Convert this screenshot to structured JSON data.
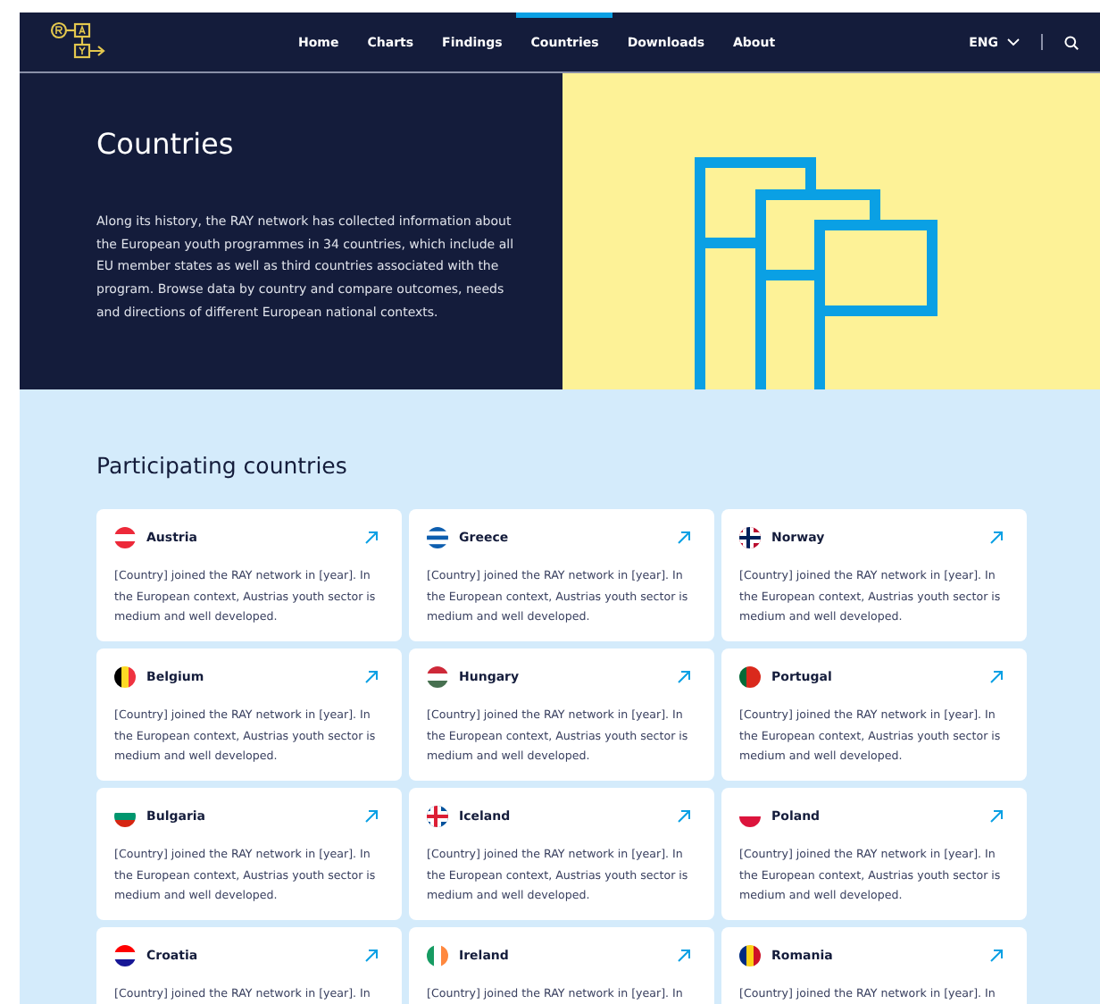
{
  "nav": {
    "links": [
      {
        "label": "Home",
        "selected": false
      },
      {
        "label": "Charts",
        "selected": false
      },
      {
        "label": "Findings",
        "selected": false
      },
      {
        "label": "Countries",
        "selected": true
      },
      {
        "label": "Downloads",
        "selected": false
      },
      {
        "label": "About",
        "selected": false
      }
    ],
    "language": "ENG"
  },
  "hero": {
    "title": "Countries",
    "text": "Along its history, the RAY network has collected information about the European youth programmes in 34 countries, which include all EU member states as well as third countries associated with the program. Browse data by country and compare outcomes, needs and directions of different European national contexts."
  },
  "section": {
    "title": "Participating countries",
    "countries": [
      {
        "name": "Austria",
        "flag": {
          "kind": "horizontal",
          "stripes": [
            {
              "color": "#ed2939"
            },
            {
              "color": "#ffffff"
            },
            {
              "color": "#ed2939"
            }
          ]
        },
        "text": "[Country] joined the RAY network in [year]. In the European context, Austrias youth sector is medium and well developed."
      },
      {
        "name": "Greece",
        "flag": {
          "kind": "horizontal",
          "stripes": [
            {
              "color": "#0d5eaf"
            },
            {
              "color": "#ffffff"
            },
            {
              "color": "#0d5eaf"
            },
            {
              "color": "#ffffff"
            },
            {
              "color": "#0d5eaf"
            }
          ]
        },
        "text": "[Country] joined the RAY network in [year]. In the European context, Austrias youth sector is medium and well developed."
      },
      {
        "name": "Norway",
        "flag": {
          "kind": "cross",
          "stripes": [
            {
              "color": "#ba0c2f"
            },
            {
              "color": "#ffffff"
            },
            {
              "color": "#00205b"
            }
          ]
        },
        "text": "[Country] joined the RAY network in [year]. In the European context, Austrias youth sector is medium and well developed."
      },
      {
        "name": "Belgium",
        "flag": {
          "kind": "vertical",
          "stripes": [
            {
              "color": "#000000"
            },
            {
              "color": "#fdda24"
            },
            {
              "color": "#ef3340"
            }
          ]
        },
        "text": "[Country] joined the RAY network in [year]. In the European context, Austrias youth sector is medium and well developed."
      },
      {
        "name": "Hungary",
        "flag": {
          "kind": "horizontal",
          "stripes": [
            {
              "color": "#ce2939"
            },
            {
              "color": "#ffffff"
            },
            {
              "color": "#477050"
            }
          ]
        },
        "text": "[Country] joined the RAY network in [year]. In the European context, Austrias youth sector is medium and well developed."
      },
      {
        "name": "Portugal",
        "flag": {
          "kind": "vertical",
          "stripes": [
            {
              "color": "#046a38"
            },
            {
              "color": "#da291c"
            },
            {
              "color": "#da291c"
            }
          ]
        },
        "text": "[Country] joined the RAY network in [year]. In the European context, Austrias youth sector is medium and well developed."
      },
      {
        "name": "Bulgaria",
        "flag": {
          "kind": "horizontal",
          "stripes": [
            {
              "color": "#ffffff"
            },
            {
              "color": "#00966e"
            },
            {
              "color": "#d62612"
            }
          ]
        },
        "text": "[Country] joined the RAY network in [year]. In the European context, Austrias youth sector is medium and well developed."
      },
      {
        "name": "Iceland",
        "flag": {
          "kind": "cross",
          "stripes": [
            {
              "color": "#02529c"
            },
            {
              "color": "#ffffff"
            },
            {
              "color": "#dc1e35"
            }
          ]
        },
        "text": "[Country] joined the RAY network in [year]. In the European context, Austrias youth sector is medium and well developed."
      },
      {
        "name": "Poland",
        "flag": {
          "kind": "horizontal",
          "stripes": [
            {
              "color": "#ffffff"
            },
            {
              "color": "#dc143c"
            }
          ]
        },
        "text": "[Country] joined the RAY network in [year]. In the European context, Austrias youth sector is medium and well developed."
      },
      {
        "name": "Croatia",
        "flag": {
          "kind": "horizontal",
          "stripes": [
            {
              "color": "#ff0000"
            },
            {
              "color": "#ffffff"
            },
            {
              "color": "#171796"
            }
          ]
        },
        "text": "[Country] joined the RAY network in [year]. In"
      },
      {
        "name": "Ireland",
        "flag": {
          "kind": "vertical",
          "stripes": [
            {
              "color": "#169b62"
            },
            {
              "color": "#ffffff"
            },
            {
              "color": "#ff883e"
            }
          ]
        },
        "text": "[Country] joined the RAY network in [year]. In"
      },
      {
        "name": "Romania",
        "flag": {
          "kind": "vertical",
          "stripes": [
            {
              "color": "#002b7f"
            },
            {
              "color": "#fcd116"
            },
            {
              "color": "#ce1126"
            }
          ]
        },
        "text": "[Country] joined the RAY network in [year]. In"
      }
    ]
  }
}
